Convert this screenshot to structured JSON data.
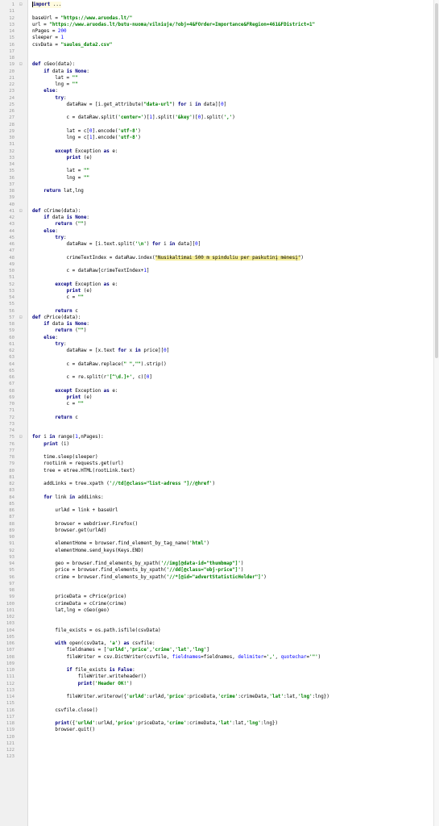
{
  "editor": {
    "line_numbers": [
      "1",
      "11",
      "12",
      "13",
      "14",
      "15",
      "16",
      "17",
      "18",
      "19",
      "20",
      "21",
      "22",
      "23",
      "24",
      "25",
      "26",
      "27",
      "28",
      "29",
      "30",
      "31",
      "32",
      "33",
      "34",
      "35",
      "36",
      "37",
      "38",
      "39",
      "40",
      "41",
      "42",
      "43",
      "44",
      "45",
      "46",
      "47",
      "48",
      "49",
      "50",
      "51",
      "52",
      "53",
      "54",
      "55",
      "56",
      "57",
      "58",
      "59",
      "60",
      "61",
      "62",
      "63",
      "64",
      "65",
      "66",
      "67",
      "68",
      "69",
      "70",
      "71",
      "72",
      "73",
      "74",
      "75",
      "76",
      "77",
      "78",
      "79",
      "80",
      "81",
      "82",
      "83",
      "84",
      "85",
      "86",
      "87",
      "88",
      "89",
      "90",
      "91",
      "92",
      "93",
      "94",
      "95",
      "96",
      "97",
      "98",
      "99",
      "100",
      "101",
      "102",
      "103",
      "104",
      "105",
      "106",
      "107",
      "108",
      "109",
      "110",
      "111",
      "112",
      "113",
      "114",
      "115",
      "116",
      "117",
      "118",
      "119",
      "120",
      "121",
      "122",
      "123"
    ],
    "lines": [
      [
        [
          "kw",
          "import"
        ],
        [
          "p",
          " ..."
        ]
      ],
      [],
      [
        [
          "p",
          "baseUrl = "
        ],
        [
          "str",
          "\"https://www.aruodas.lt/\""
        ]
      ],
      [
        [
          "p",
          "url = "
        ],
        [
          "str",
          "\"https://www.aruodas.lt/butu-nuoma/vilniuje/?obj=4&FOrder=Importance&FRegion=461&FDistrict=1\""
        ]
      ],
      [
        [
          "p",
          "nPages = "
        ],
        [
          "num",
          "200"
        ]
      ],
      [
        [
          "p",
          "sleeper = "
        ],
        [
          "num",
          "1"
        ]
      ],
      [
        [
          "p",
          "csvData = "
        ],
        [
          "str",
          "\"saules_data2.csv\""
        ]
      ],
      [],
      [],
      [
        [
          "kw",
          "def "
        ],
        [
          "p",
          "cGeo(data):"
        ]
      ],
      [
        [
          "p",
          "    "
        ],
        [
          "kw",
          "if "
        ],
        [
          "p",
          "data "
        ],
        [
          "kw",
          "is None"
        ],
        [
          "p",
          ":"
        ]
      ],
      [
        [
          "p",
          "        lat = "
        ],
        [
          "str",
          "\"\""
        ]
      ],
      [
        [
          "p",
          "        lng = "
        ],
        [
          "str",
          "\"\""
        ]
      ],
      [
        [
          "p",
          "    "
        ],
        [
          "kw",
          "else"
        ],
        [
          "p",
          ":"
        ]
      ],
      [
        [
          "p",
          "        "
        ],
        [
          "kw",
          "try"
        ],
        [
          "p",
          ":"
        ]
      ],
      [
        [
          "p",
          "            dataRaw = [i.get_attribute("
        ],
        [
          "str",
          "\"data-url\""
        ],
        [
          "p",
          ") "
        ],
        [
          "kw",
          "for "
        ],
        [
          "p",
          "i "
        ],
        [
          "kw",
          "in "
        ],
        [
          "p",
          "data]["
        ],
        [
          "num",
          "0"
        ],
        [
          "p",
          "]"
        ]
      ],
      [],
      [
        [
          "p",
          "            c = dataRaw.split("
        ],
        [
          "str",
          "'center='"
        ],
        [
          "p",
          ")["
        ],
        [
          "num",
          "1"
        ],
        [
          "p",
          "].split("
        ],
        [
          "str",
          "'&key'"
        ],
        [
          "p",
          ")["
        ],
        [
          "num",
          "0"
        ],
        [
          "p",
          "].split("
        ],
        [
          "str",
          "','"
        ],
        [
          "p",
          ")"
        ]
      ],
      [],
      [
        [
          "p",
          "            lat = c["
        ],
        [
          "num",
          "0"
        ],
        [
          "p",
          "].encode("
        ],
        [
          "str",
          "'utf-8'"
        ],
        [
          "p",
          ")"
        ]
      ],
      [
        [
          "p",
          "            lng = c["
        ],
        [
          "num",
          "1"
        ],
        [
          "p",
          "].encode("
        ],
        [
          "str",
          "'utf-8'"
        ],
        [
          "p",
          ")"
        ]
      ],
      [],
      [
        [
          "p",
          "        "
        ],
        [
          "kw",
          "except "
        ],
        [
          "p",
          "Exception "
        ],
        [
          "kw",
          "as "
        ],
        [
          "p",
          "e:"
        ]
      ],
      [
        [
          "p",
          "            "
        ],
        [
          "kw",
          "print "
        ],
        [
          "p",
          "(e)"
        ]
      ],
      [],
      [
        [
          "p",
          "            lat = "
        ],
        [
          "str",
          "\"\""
        ]
      ],
      [
        [
          "p",
          "            lng = "
        ],
        [
          "str",
          "\"\""
        ]
      ],
      [],
      [
        [
          "p",
          "    "
        ],
        [
          "kw",
          "return "
        ],
        [
          "p",
          "lat,lng"
        ]
      ],
      [],
      [],
      [
        [
          "kw",
          "def "
        ],
        [
          "p",
          "cCrime(data):"
        ]
      ],
      [
        [
          "p",
          "    "
        ],
        [
          "kw",
          "if "
        ],
        [
          "p",
          "data "
        ],
        [
          "kw",
          "is None"
        ],
        [
          "p",
          ":"
        ]
      ],
      [
        [
          "p",
          "        "
        ],
        [
          "kw",
          "return "
        ],
        [
          "p",
          "("
        ],
        [
          "str",
          "\"\""
        ],
        [
          "p",
          ")"
        ]
      ],
      [
        [
          "p",
          "    "
        ],
        [
          "kw",
          "else"
        ],
        [
          "p",
          ":"
        ]
      ],
      [
        [
          "p",
          "        "
        ],
        [
          "kw",
          "try"
        ],
        [
          "p",
          ":"
        ]
      ],
      [
        [
          "p",
          "            dataRaw = [i.text.split("
        ],
        [
          "str",
          "'\\n'"
        ],
        [
          "p",
          ") "
        ],
        [
          "kw",
          "for "
        ],
        [
          "p",
          "i "
        ],
        [
          "kw",
          "in "
        ],
        [
          "p",
          "data]["
        ],
        [
          "num",
          "0"
        ],
        [
          "p",
          "]"
        ]
      ],
      [],
      [
        [
          "p",
          "            crimeTextIndex = dataRaw.index("
        ],
        [
          "hl",
          "\"Nusikaltimai 500 m spinduliu per paskutinį mėnesį\""
        ],
        [
          "p",
          ")"
        ]
      ],
      [],
      [
        [
          "p",
          "            c = dataRaw[crimeTextIndex+"
        ],
        [
          "num",
          "1"
        ],
        [
          "p",
          "]"
        ]
      ],
      [],
      [
        [
          "p",
          "        "
        ],
        [
          "kw",
          "except "
        ],
        [
          "p",
          "Exception "
        ],
        [
          "kw",
          "as "
        ],
        [
          "p",
          "e:"
        ]
      ],
      [
        [
          "p",
          "            "
        ],
        [
          "kw",
          "print "
        ],
        [
          "p",
          "(e)"
        ]
      ],
      [
        [
          "p",
          "            c = "
        ],
        [
          "str",
          "\"\""
        ]
      ],
      [],
      [
        [
          "p",
          "        "
        ],
        [
          "kw",
          "return "
        ],
        [
          "p",
          "c"
        ]
      ],
      [
        [
          "kw",
          "def "
        ],
        [
          "p",
          "cPrice(data):"
        ]
      ],
      [
        [
          "p",
          "    "
        ],
        [
          "kw",
          "if "
        ],
        [
          "p",
          "data "
        ],
        [
          "kw",
          "is None"
        ],
        [
          "p",
          ":"
        ]
      ],
      [
        [
          "p",
          "        "
        ],
        [
          "kw",
          "return "
        ],
        [
          "p",
          "("
        ],
        [
          "str",
          "\"\""
        ],
        [
          "p",
          ")"
        ]
      ],
      [
        [
          "p",
          "    "
        ],
        [
          "kw",
          "else"
        ],
        [
          "p",
          ":"
        ]
      ],
      [
        [
          "p",
          "        "
        ],
        [
          "kw",
          "try"
        ],
        [
          "p",
          ":"
        ]
      ],
      [
        [
          "p",
          "            dataRaw = [x.text "
        ],
        [
          "kw",
          "for "
        ],
        [
          "p",
          "x "
        ],
        [
          "kw",
          "in "
        ],
        [
          "p",
          "price]["
        ],
        [
          "num",
          "0"
        ],
        [
          "p",
          "]"
        ]
      ],
      [],
      [
        [
          "p",
          "            c = dataRaw.replace("
        ],
        [
          "str",
          "\" \""
        ],
        [
          "p",
          ","
        ],
        [
          "str",
          "\"\""
        ],
        [
          "p",
          ").strip()"
        ]
      ],
      [],
      [
        [
          "p",
          "            c = re.split(r"
        ],
        [
          "str",
          "'[^\\d.]+'"
        ],
        [
          "p",
          ", c)["
        ],
        [
          "num",
          "0"
        ],
        [
          "p",
          "]"
        ]
      ],
      [],
      [
        [
          "p",
          "        "
        ],
        [
          "kw",
          "except "
        ],
        [
          "p",
          "Exception "
        ],
        [
          "kw",
          "as "
        ],
        [
          "p",
          "e:"
        ]
      ],
      [
        [
          "p",
          "            "
        ],
        [
          "kw",
          "print "
        ],
        [
          "p",
          "(e)"
        ]
      ],
      [
        [
          "p",
          "            c = "
        ],
        [
          "str",
          "\"\""
        ]
      ],
      [],
      [
        [
          "p",
          "        "
        ],
        [
          "kw",
          "return "
        ],
        [
          "p",
          "c"
        ]
      ],
      [],
      [],
      [
        [
          "kw",
          "for "
        ],
        [
          "p",
          "i "
        ],
        [
          "kw",
          "in "
        ],
        [
          "p",
          "range("
        ],
        [
          "num",
          "1"
        ],
        [
          "p",
          ",nPages):"
        ]
      ],
      [
        [
          "p",
          "    "
        ],
        [
          "kw",
          "print "
        ],
        [
          "p",
          "(i)"
        ]
      ],
      [],
      [
        [
          "p",
          "    time.sleep(sleeper)"
        ]
      ],
      [
        [
          "p",
          "    rootLink = requests.get(url)"
        ]
      ],
      [
        [
          "p",
          "    tree = etree.HTML(rootLink.text)"
        ]
      ],
      [],
      [
        [
          "p",
          "    addLinks = tree.xpath ("
        ],
        [
          "str",
          "'//td[@class=\"list-adress \"]//@href'"
        ],
        [
          "p",
          ")"
        ]
      ],
      [],
      [
        [
          "p",
          "    "
        ],
        [
          "kw",
          "for "
        ],
        [
          "p",
          "link "
        ],
        [
          "kw",
          "in "
        ],
        [
          "p",
          "addLinks:"
        ]
      ],
      [],
      [
        [
          "p",
          "        urlAd = link + baseUrl"
        ]
      ],
      [],
      [
        [
          "p",
          "        browser = webdriver.Firefox()"
        ]
      ],
      [
        [
          "p",
          "        browser.get(urlAd)"
        ]
      ],
      [],
      [
        [
          "p",
          "        elementHome = browser.find_element_by_tag_name("
        ],
        [
          "str",
          "'html'"
        ],
        [
          "p",
          ")"
        ]
      ],
      [
        [
          "p",
          "        elementHome.send_keys(Keys.END)"
        ]
      ],
      [],
      [
        [
          "p",
          "        geo = browser.find_elements_by_xpath("
        ],
        [
          "str",
          "'//img[@data-id=\"thumbmap\"]'"
        ],
        [
          "p",
          ")"
        ]
      ],
      [
        [
          "p",
          "        price = browser.find_elements_by_xpath("
        ],
        [
          "str",
          "'//dd[@class=\"obj-price\"]'"
        ],
        [
          "p",
          ")"
        ]
      ],
      [
        [
          "p",
          "        crime = browser.find_elements_by_xpath("
        ],
        [
          "str",
          "'//*[@id=\"advertStatisticHolder\"]'"
        ],
        [
          "p",
          ")"
        ]
      ],
      [],
      [],
      [
        [
          "p",
          "        priceData = cPrice(price)"
        ]
      ],
      [
        [
          "p",
          "        crimeData = cCrime(crime)"
        ]
      ],
      [
        [
          "p",
          "        lat,lng = cGeo(geo)"
        ]
      ],
      [],
      [],
      [
        [
          "p",
          "        file_exists = os.path.isfile(csvData)"
        ]
      ],
      [],
      [
        [
          "p",
          "        "
        ],
        [
          "kw",
          "with "
        ],
        [
          "p",
          "open(csvData, "
        ],
        [
          "str",
          "'a'"
        ],
        [
          "p",
          ") "
        ],
        [
          "kw",
          "as "
        ],
        [
          "p",
          "csvfile:"
        ]
      ],
      [
        [
          "p",
          "            fieldnames = ["
        ],
        [
          "str",
          "'urlAd'"
        ],
        [
          "p",
          ","
        ],
        [
          "str",
          "'price'"
        ],
        [
          "p",
          ","
        ],
        [
          "str",
          "'crime'"
        ],
        [
          "p",
          ","
        ],
        [
          "str",
          "'lat'"
        ],
        [
          "p",
          ","
        ],
        [
          "str",
          "'lng'"
        ],
        [
          "p",
          "]"
        ]
      ],
      [
        [
          "p",
          "            fileWriter = csv.DictWriter(csvfile, "
        ],
        [
          "num",
          "fieldnames"
        ],
        [
          "p",
          "=fieldnames, "
        ],
        [
          "num",
          "delimiter"
        ],
        [
          "p",
          "="
        ],
        [
          "str",
          "','"
        ],
        [
          "p",
          ", "
        ],
        [
          "num",
          "quotechar"
        ],
        [
          "p",
          "="
        ],
        [
          "str",
          "'\"'"
        ],
        [
          "p",
          ")"
        ]
      ],
      [],
      [
        [
          "p",
          "            "
        ],
        [
          "kw",
          "if "
        ],
        [
          "p",
          "file_exists "
        ],
        [
          "kw",
          "is False"
        ],
        [
          "p",
          ":"
        ]
      ],
      [
        [
          "p",
          "                fileWriter.writeheader()"
        ]
      ],
      [
        [
          "p",
          "                "
        ],
        [
          "kw",
          "print"
        ],
        [
          "p",
          "("
        ],
        [
          "str",
          "'Header OK!'"
        ],
        [
          "p",
          ")"
        ]
      ],
      [],
      [
        [
          "p",
          "            fileWriter.writerow({"
        ],
        [
          "str",
          "'urlAd'"
        ],
        [
          "p",
          ":urlAd,"
        ],
        [
          "str",
          "'price'"
        ],
        [
          "p",
          ":priceData,"
        ],
        [
          "str",
          "'crime'"
        ],
        [
          "p",
          ":crimeData,"
        ],
        [
          "str",
          "'lat'"
        ],
        [
          "p",
          ":lat,"
        ],
        [
          "str",
          "'lng'"
        ],
        [
          "p",
          ":lng})"
        ]
      ],
      [],
      [
        [
          "p",
          "        csvfile.close()"
        ]
      ],
      [],
      [
        [
          "p",
          "        "
        ],
        [
          "kw",
          "print"
        ],
        [
          "p",
          "({"
        ],
        [
          "str",
          "'urlAd'"
        ],
        [
          "p",
          ":urlAd,"
        ],
        [
          "str",
          "'price'"
        ],
        [
          "p",
          ":priceData,"
        ],
        [
          "str",
          "'crime'"
        ],
        [
          "p",
          ":crimeData,"
        ],
        [
          "str",
          "'lat'"
        ],
        [
          "p",
          ":lat,"
        ],
        [
          "str",
          "'lng'"
        ],
        [
          "p",
          ":lng})"
        ]
      ],
      [
        [
          "p",
          "        browser.quit()"
        ]
      ],
      []
    ],
    "colors": {
      "keyword": "#000080",
      "string": "#008000",
      "number": "#0000ff",
      "highlight": "#f6ef9c",
      "gutter": "#f0f0f0"
    }
  }
}
